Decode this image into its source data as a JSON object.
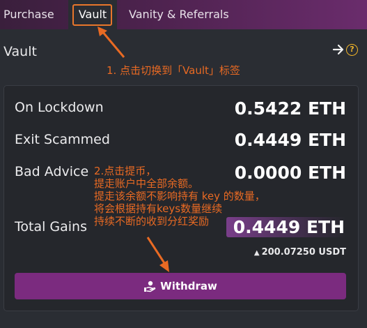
{
  "tabs": {
    "purchase": "Purchase",
    "vault": "Vault",
    "vanity": "Vanity & Referrals"
  },
  "header": {
    "title": "Vault"
  },
  "vault": {
    "rows": [
      {
        "label": "On Lockdown",
        "value": "0.5422 ETH"
      },
      {
        "label": "Exit Scammed",
        "value": "0.4449 ETH"
      },
      {
        "label": "Bad Advice",
        "value": "0.0000 ETH"
      },
      {
        "label": "Total Gains",
        "value": "0.4449 ETH"
      }
    ],
    "usdt_value": "200.07250 USDT",
    "withdraw_label": "Withdraw"
  },
  "annotations": {
    "step1": "1. 点击切换到「Vault」标签",
    "step2_lines": [
      "2.点击提币，",
      "提走账户中全部余额。",
      "提走该余额不影响持有 key 的数量，",
      "将会根据持有keys数量继续",
      "持续不断的收到分红奖励"
    ]
  },
  "colors": {
    "accent": "#7b2b7f",
    "annotation": "#e96a23",
    "help": "#f0b429",
    "background": "#2a2d33"
  },
  "icons": {
    "arrow": "arrow-right-icon",
    "help": "help-icon",
    "withdraw": "hand-money-icon",
    "usdt": "ethereum-icon"
  }
}
